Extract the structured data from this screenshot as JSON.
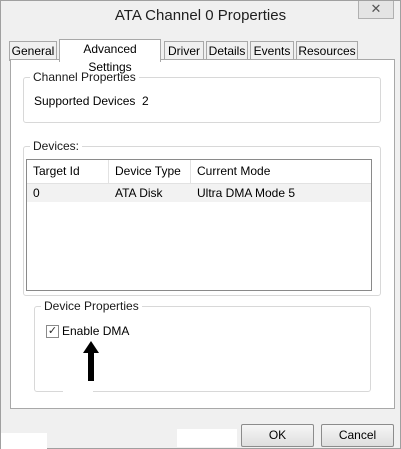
{
  "window": {
    "title": "ATA Channel 0 Properties",
    "close_glyph": "✕"
  },
  "tabs": [
    {
      "label": "General"
    },
    {
      "label": "Advanced Settings",
      "active": true
    },
    {
      "label": "Driver"
    },
    {
      "label": "Details"
    },
    {
      "label": "Events"
    },
    {
      "label": "Resources"
    }
  ],
  "channel_properties": {
    "group_label": "Channel Properties",
    "supported_devices_label": "Supported Devices",
    "supported_devices_value": "2"
  },
  "devices": {
    "group_label": "Devices:",
    "columns": [
      "Target Id",
      "Device Type",
      "Current Mode"
    ],
    "rows": [
      {
        "target_id": "0",
        "device_type": "ATA Disk",
        "current_mode": "Ultra DMA Mode 5"
      }
    ]
  },
  "device_properties": {
    "group_label": "Device Properties",
    "enable_dma_label": "Enable DMA",
    "enable_dma_checked": true,
    "check_glyph": "✓"
  },
  "buttons": {
    "ok_label": "OK",
    "cancel_label": "Cancel"
  }
}
